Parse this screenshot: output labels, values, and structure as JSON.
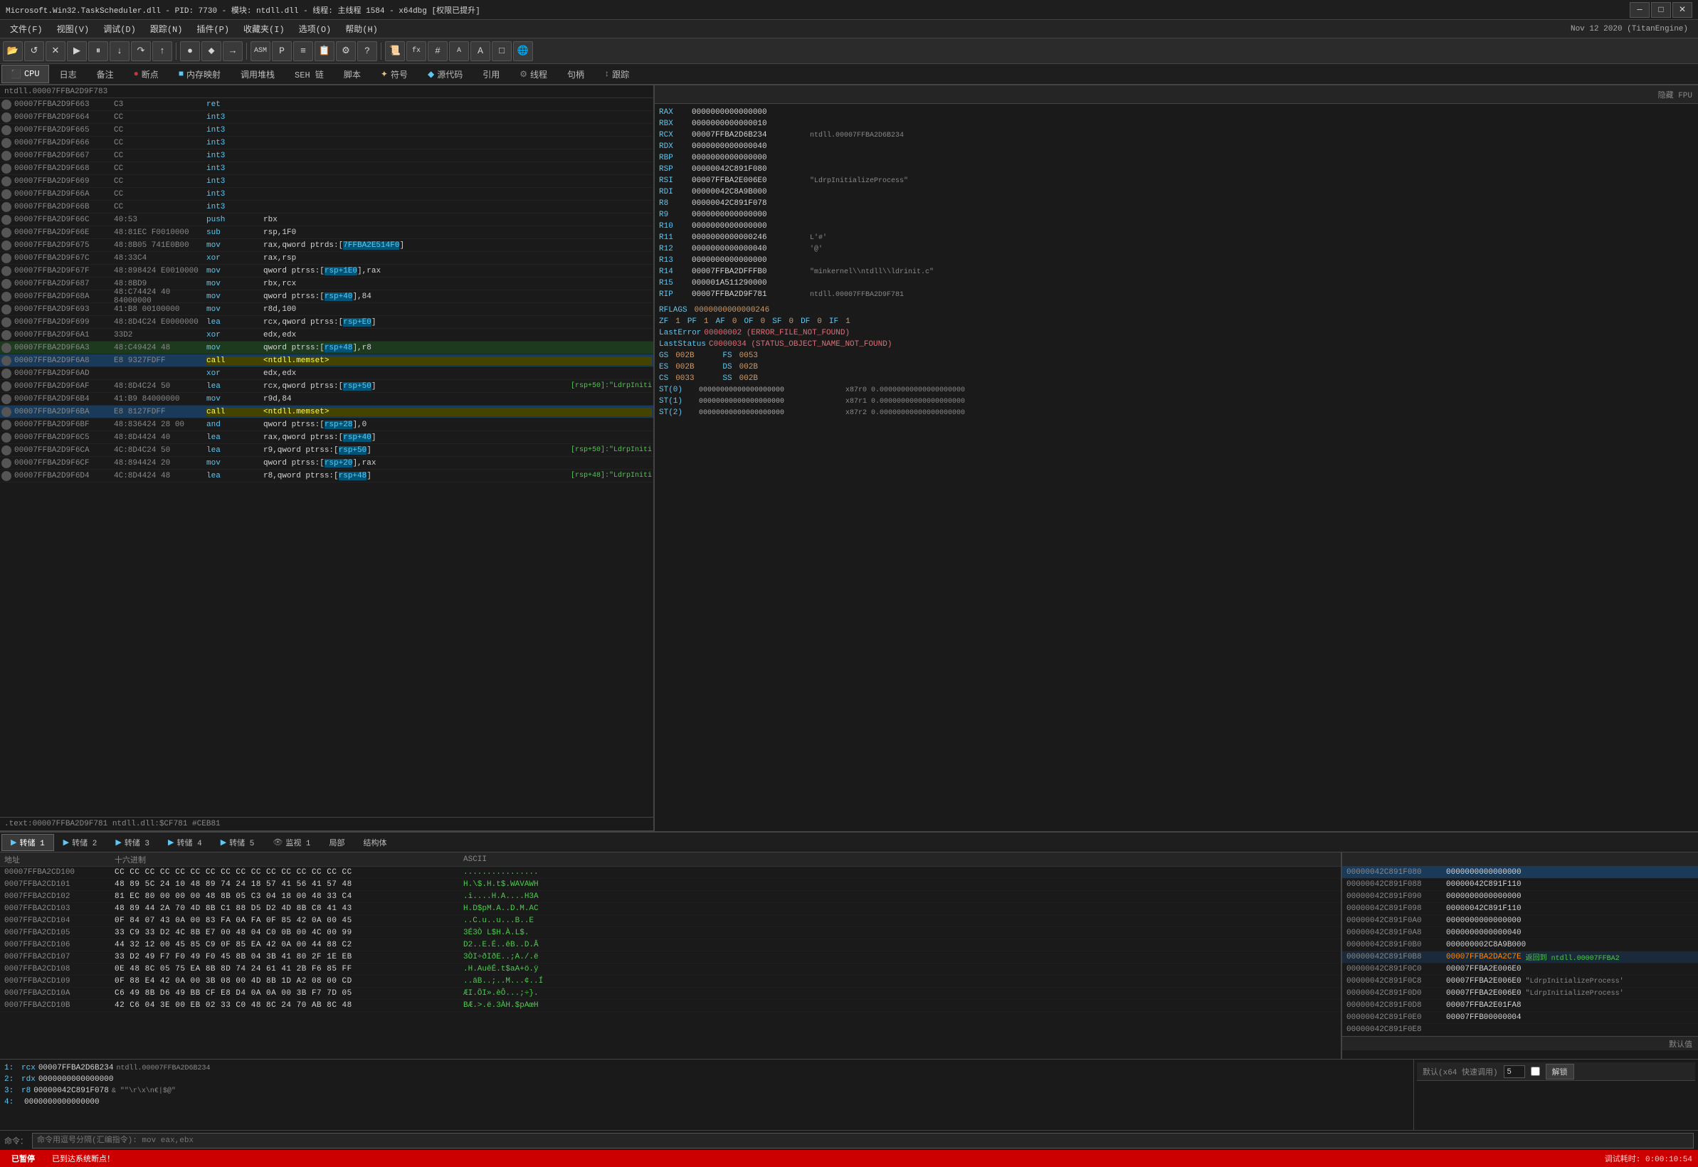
{
  "titlebar": {
    "text": "Microsoft.Win32.TaskScheduler.dll - PID: 7730 - 模块: ntdll.dll - 线程: 主线程 1584 - x64dbg [权限已提升]",
    "minimize": "─",
    "maximize": "□",
    "close": "✕"
  },
  "menubar": {
    "items": [
      "文件(F)",
      "视图(V)",
      "调试(D)",
      "跟踪(N)",
      "插件(P)",
      "收藏夹(I)",
      "选项(O)",
      "帮助(H)"
    ],
    "date": "Nov 12 2020 (TitanEngine)"
  },
  "tabs": {
    "cpu": "CPU",
    "log": "日志",
    "notes": "备注",
    "breakpoints": "断点",
    "memory": "内存映射",
    "callstack": "调用堆栈",
    "seh": "SEH 链",
    "script": "脚本",
    "symbols": "符号",
    "source": "源代码",
    "references": "引用",
    "threads": "线程",
    "patches": "句柄",
    "trace": "跟踪"
  },
  "registers": {
    "header": "隐藏 FPU",
    "regs": [
      {
        "name": "RAX",
        "val": "0000000000000000",
        "comment": ""
      },
      {
        "name": "RBX",
        "val": "0000000000000010",
        "comment": ""
      },
      {
        "name": "RCX",
        "val": "00007FFBA2D6B234",
        "comment": "ntdll.00007FFBA2D6B234"
      },
      {
        "name": "RDX",
        "val": "0000000000000040",
        "comment": ""
      },
      {
        "name": "RBP",
        "val": "0000000000000000",
        "comment": ""
      },
      {
        "name": "RSP",
        "val": "00000042C891F080",
        "comment": ""
      },
      {
        "name": "RSI",
        "val": "00007FFBA2E006E0",
        "comment": "\"LdrpInitializeProcess\""
      },
      {
        "name": "RDI",
        "val": "00000042C8A9B000",
        "comment": ""
      },
      {
        "name": "R8",
        "val": "00000042C891F078",
        "comment": ""
      },
      {
        "name": "R9",
        "val": "0000000000000000",
        "comment": ""
      },
      {
        "name": "R10",
        "val": "0000000000000000",
        "comment": ""
      },
      {
        "name": "R11",
        "val": "0000000000000246",
        "comment": "L'#'"
      },
      {
        "name": "R12",
        "val": "0000000000000040",
        "comment": "'@'"
      },
      {
        "name": "R13",
        "val": "0000000000000000",
        "comment": ""
      },
      {
        "name": "R14",
        "val": "00007FFBA2DFFFB0",
        "comment": "\"minkernel\\\\ntdll\\\\ldrinit.c\""
      },
      {
        "name": "R15",
        "val": "000001A511290000",
        "comment": ""
      },
      {
        "name": "RIP",
        "val": "00007FFBA2D9F781",
        "comment": "ntdll.00007FFBA2D9F781"
      }
    ],
    "rflags": "0000000000000246",
    "flags": [
      {
        "name": "ZF",
        "val": "1"
      },
      {
        "name": "PF",
        "val": "1"
      },
      {
        "name": "AF",
        "val": "0"
      },
      {
        "name": "OF",
        "val": "0"
      },
      {
        "name": "SF",
        "val": "0"
      },
      {
        "name": "DF",
        "val": "0"
      },
      {
        "name": "IF",
        "val": "1"
      }
    ],
    "lasterror": "00000002 (ERROR_FILE_NOT_FOUND)",
    "laststatus": "C0000034 (STATUS_OBJECT_NAME_NOT_FOUND)",
    "seg_regs": [
      {
        "name": "GS",
        "val": "002B",
        "name2": "FS",
        "val2": "0053"
      },
      {
        "name": "ES",
        "val": "002B",
        "name2": "DS",
        "val2": "002B"
      },
      {
        "name": "CS",
        "val": "0033",
        "name2": "SS",
        "val2": "002B"
      }
    ],
    "st_regs": [
      {
        "name": "ST(0)",
        "val": "00000000000000000000",
        "extra": "x87r0  0.00000000000000000000"
      },
      {
        "name": "ST(1)",
        "val": "00000000000000000000",
        "extra": "x87r1  0.00000000000000000000"
      },
      {
        "name": "ST(2)",
        "val": "00000000000000000000",
        "extra": "x87r2  0.00000000000000000000"
      }
    ]
  },
  "disasm": {
    "rows": [
      {
        "addr": "00007FFBA2D9F663",
        "bytes": "C3",
        "mnem": "ret",
        "ops": "",
        "comment": ""
      },
      {
        "addr": "00007FFBA2D9F664",
        "bytes": "CC",
        "mnem": "int3",
        "ops": "",
        "comment": ""
      },
      {
        "addr": "00007FFBA2D9F665",
        "bytes": "CC",
        "mnem": "int3",
        "ops": "",
        "comment": ""
      },
      {
        "addr": "00007FFBA2D9F666",
        "bytes": "CC",
        "mnem": "int3",
        "ops": "",
        "comment": ""
      },
      {
        "addr": "00007FFBA2D9F667",
        "bytes": "CC",
        "mnem": "int3",
        "ops": "",
        "comment": ""
      },
      {
        "addr": "00007FFBA2D9F668",
        "bytes": "CC",
        "mnem": "int3",
        "ops": "",
        "comment": ""
      },
      {
        "addr": "00007FFBA2D9F669",
        "bytes": "CC",
        "mnem": "int3",
        "ops": "",
        "comment": ""
      },
      {
        "addr": "00007FFBA2D9F66A",
        "bytes": "CC",
        "mnem": "int3",
        "ops": "",
        "comment": ""
      },
      {
        "addr": "00007FFBA2D9F66B",
        "bytes": "CC",
        "mnem": "int3",
        "ops": "",
        "comment": ""
      },
      {
        "addr": "00007FFBA2D9F66C",
        "bytes": "40:53",
        "mnem": "push",
        "ops": "rbx",
        "comment": ""
      },
      {
        "addr": "00007FFBA2D9F66E",
        "bytes": "48:81EC F0010000",
        "mnem": "sub",
        "ops": "rsp,1F0",
        "comment": ""
      },
      {
        "addr": "00007FFBA2D9F675",
        "bytes": "48:8B05 741E0B00",
        "mnem": "mov",
        "ops": "rax,qword ptrds:[7FFBA2E514F0]",
        "comment": "",
        "highlight_ops": "7FFBA2E514F0"
      },
      {
        "addr": "00007FFBA2D9F67C",
        "bytes": "48:33C4",
        "mnem": "xor",
        "ops": "rax,rsp",
        "comment": ""
      },
      {
        "addr": "00007FFBA2D9F67F",
        "bytes": "48:898424 E0010000",
        "mnem": "mov",
        "ops": "qword ptrss:[rsp+1E0],rax",
        "comment": "",
        "highlight_ops": "rsp+1E0"
      },
      {
        "addr": "00007FFBA2D9F687",
        "bytes": "48:8BD9",
        "mnem": "mov",
        "ops": "rbx,rcx",
        "comment": ""
      },
      {
        "addr": "00007FFBA2D9F68A",
        "bytes": "48:C74424 40 84000000",
        "mnem": "mov",
        "ops": "qword ptrss:[rsp+40],84",
        "comment": "",
        "highlight_ops": "rsp+40"
      },
      {
        "addr": "00007FFBA2D9F693",
        "bytes": "41:B8 00100000",
        "mnem": "mov",
        "ops": "r8d,100",
        "comment": ""
      },
      {
        "addr": "00007FFBA2D9F699",
        "bytes": "48:8D4C24 E0000000",
        "mnem": "lea",
        "ops": "rcx,qword ptrss:[rsp+E0]",
        "comment": "",
        "highlight_ops": "rsp+E0"
      },
      {
        "addr": "00007FFBA2D9F6A1",
        "bytes": "33D2",
        "mnem": "xor",
        "ops": "edx,edx",
        "comment": ""
      },
      {
        "addr": "00007FFBA2D9F6A3",
        "bytes": "48:C49424 48",
        "mnem": "mov",
        "ops": "qword ptrss:[rsp+48],r8",
        "comment": "",
        "highlight_ops": "rsp+48"
      },
      {
        "addr": "00007FFBA2D9F6A8",
        "bytes": "E8 9327FDFF",
        "mnem": "call",
        "ops": "<ntdll.memset>",
        "comment": "",
        "is_call": true
      },
      {
        "addr": "00007FFBA2D9F6AD",
        "bytes": "",
        "mnem": "xor",
        "ops": "edx,edx",
        "comment": ""
      },
      {
        "addr": "00007FFBA2D9F6AF",
        "bytes": "48:8D4C24 50",
        "mnem": "lea",
        "ops": "rcx,qword ptrss:[rsp+50]",
        "comment": "[rsp+50]:\"LdrpIniti",
        "highlight_ops": "rsp+50"
      },
      {
        "addr": "00007FFBA2D9F6B4",
        "bytes": "41:B9 84000000",
        "mnem": "mov",
        "ops": "r9d,84",
        "comment": ""
      },
      {
        "addr": "00007FFBA2D9F6BA",
        "bytes": "E8 8127FDFF",
        "mnem": "call",
        "ops": "<ntdll.memset>",
        "comment": "",
        "is_call": true
      },
      {
        "addr": "00007FFBA2D9F6BF",
        "bytes": "48:836424 28 00",
        "mnem": "and",
        "ops": "qword ptrss:[rsp+28],0",
        "comment": "",
        "highlight_ops": "rsp+28"
      },
      {
        "addr": "00007FFBA2D9F6C5",
        "bytes": "48:8D4424 40",
        "mnem": "lea",
        "ops": "rax,qword ptrss:[rsp+40]",
        "comment": "",
        "highlight_ops": "rsp+40"
      },
      {
        "addr": "00007FFBA2D9F6CA",
        "bytes": "4C:8D4C24 50",
        "mnem": "lea",
        "ops": "r9,qword ptrss:[rsp+50]",
        "comment": "[rsp+50]:\"LdrpIniti",
        "highlight_ops": "rsp+50"
      },
      {
        "addr": "00007FFBA2D9F6CF",
        "bytes": "48:894424 20",
        "mnem": "mov",
        "ops": "qword ptrss:[rsp+20],rax",
        "comment": "",
        "highlight_ops": "rsp+20"
      },
      {
        "addr": "00007FFBA2D9F6D4",
        "bytes": "4C:8D4424 48",
        "mnem": "lea",
        "ops": "r8,qword ptrss:[rsp+48]",
        "comment": "[rsp+48]:\"LdrpIniti",
        "highlight_ops": "rsp+48"
      }
    ],
    "current_addr": "ntdll.00007FFBA2D9F783",
    "asm_line": ".text:00007FFBA2D9F781 ntdll.dll:$CF781 #CEB81"
  },
  "watch": {
    "rows": [
      {
        "num": "1:",
        "expr": "rcx",
        "val": "00007FFBA2D6B234",
        "comment": "ntdll.00007FFBA2D6B234"
      },
      {
        "num": "2:",
        "expr": "rdx",
        "val": "0000000000000000",
        "comment": ""
      },
      {
        "num": "3:",
        "expr": "r8",
        "val": "00000042C891F078",
        "comment": "& \"\"\\r\\x\\n€|$@\""
      },
      {
        "num": "4:",
        "expr": "",
        "val": "0000000000000000",
        "comment": ""
      }
    ]
  },
  "quickresolve": {
    "label": "默认(x64 快速调用)",
    "val": "5",
    "btn": "解锁"
  },
  "hexdump": {
    "tab_label": "转储",
    "tabs": [
      "转储 1",
      "转储 2",
      "转储 3",
      "转储 4",
      "转储 5",
      "监视 1",
      "局部",
      "结构体"
    ],
    "header": {
      "addr": "地址",
      "hex": "十六进制",
      "ascii": "ASCII"
    },
    "rows": [
      {
        "addr": "00007FFBA2CD100",
        "bytes": "CC CC CC CC CC CC CC CC CC CC CC CC CC CC CC CC",
        "ascii": "................"
      },
      {
        "addr": "0007FFBA2CD101",
        "bytes": "48 89 5C 24 10 48 89 74 24 18 57 41 56 41 57 48",
        "ascii": "H.\\$.H.t$.WAVAWH"
      },
      {
        "addr": "0007FFBA2CD102",
        "bytes": "81 EC 80 00 00 00 48 8B 05 C3 04 18 00 48 33 C4",
        "ascii": ".i....H.A....H3A"
      },
      {
        "addr": "0007FFBA2CD103",
        "bytes": "48 89 44 2A 70 4D 8B C1 88 D5 D2 4D 8B C8 41 43",
        "ascii": "H.D$pM.A..D.M.AC"
      },
      {
        "addr": "0007FFBA2CD104",
        "bytes": "0F 84 07 43 0A 00 83 FA 0A FA 0F 85 42 0A 00 45",
        "ascii": "..C.u..u...B..E"
      },
      {
        "addr": "0007FFBA2CD105",
        "bytes": "33 C9 33 D2 4C 8B E7 00 48 04 C0 0B 00 4C 00 99",
        "ascii": "3É3Ò L$H.À.L$."
      },
      {
        "addr": "0007FFBA2CD106",
        "bytes": "44 32 12 00 45 85 C9 0F 85 EA 42 0A 00 44 88 C2",
        "ascii": "D2..E.É..êB..D.Â"
      },
      {
        "addr": "0007FFBA2CD107",
        "bytes": "33 D2 49 F7 F0 49 F0 45 8B 04 3B 41 80 2F 1E EB",
        "ascii": "3ÒI÷ðIðE..;A./.ë"
      },
      {
        "addr": "0007FFBA2CD108",
        "bytes": "0E 48 8C 05 75 EA 8B 8D 74 24 61 41 2B F6 85 FF",
        "ascii": ".H.AuêÉ.t$aA+ö.ÿ"
      },
      {
        "addr": "0007FFBA2CD109",
        "bytes": "0F 88 E4 42 0A 00 3B 08 00 4D 8B 1D A2 08 00 CD",
        "ascii": "..äB..;..M...¢..Í"
      },
      {
        "addr": "0007FFBA2CD10A",
        "bytes": "C6 49 8B D6 49 BB CF E8 D4 0A 0A 00 3B F7 7D 05",
        "ascii": "ÆI.ÖI».èÔ...;÷}."
      },
      {
        "addr": "0007FFBA2CD10B",
        "bytes": "42 C6 04 3E 00 EB 02 33 C0 48 8C 24 70 AB 8C 48",
        "ascii": "BÆ.>.ë.3ÀH.$pAœH"
      }
    ]
  },
  "memview": {
    "header": {
      "addr": "",
      "val": ""
    },
    "rows": [
      {
        "addr": "00000042C891F080",
        "val": "0000000000000000",
        "comment": "",
        "is_active": true
      },
      {
        "addr": "00000042C891F088",
        "val": "00000042C891F110",
        "comment": ""
      },
      {
        "addr": "00000042C891F090",
        "val": "0000000000000000",
        "comment": ""
      },
      {
        "addr": "00000042C891F098",
        "val": "00000042C891F110",
        "comment": ""
      },
      {
        "addr": "00000042C891F0A0",
        "val": "0000000000000000",
        "comment": ""
      },
      {
        "addr": "00000042C891F0A8",
        "val": "0000000000000040",
        "comment": ""
      },
      {
        "addr": "00000042C891F0B0",
        "val": "000000002C8A9B000",
        "comment": ""
      },
      {
        "addr": "00000042C891F0B8",
        "val": "00007FFBA2DA2C7E",
        "comment": "返回到 ntdll.00007FFBA2",
        "highlight": true
      },
      {
        "addr": "00000042C891F0C0",
        "val": "00007FFBA2E006E0",
        "comment": ""
      },
      {
        "addr": "00000042C891F0C8",
        "val": "00007FFBA2E006E0",
        "comment": "\"LdrpInitializeProcess'"
      },
      {
        "addr": "00000042C891F0D0",
        "val": "00007FFBA2E006E0",
        "comment": "\"LdrpInitializeProcess'"
      },
      {
        "addr": "00000042C891F0D8",
        "val": "00007FFBA2E01FA8",
        "comment": ""
      },
      {
        "addr": "00000042C891F0E0",
        "val": "00007FFB00000004",
        "comment": ""
      },
      {
        "addr": "00000042C891F0E8",
        "val": "",
        "comment": ""
      }
    ]
  },
  "statusbar": {
    "paused": "已暂停",
    "msg": "已到达系统断点！",
    "time": "调试耗时: 0:00:10:54"
  },
  "cmdbar": {
    "label": "命令：",
    "placeholder": "命令用逗号分隔(汇编指令): mov eax,ebx"
  },
  "default_val": "默认值"
}
